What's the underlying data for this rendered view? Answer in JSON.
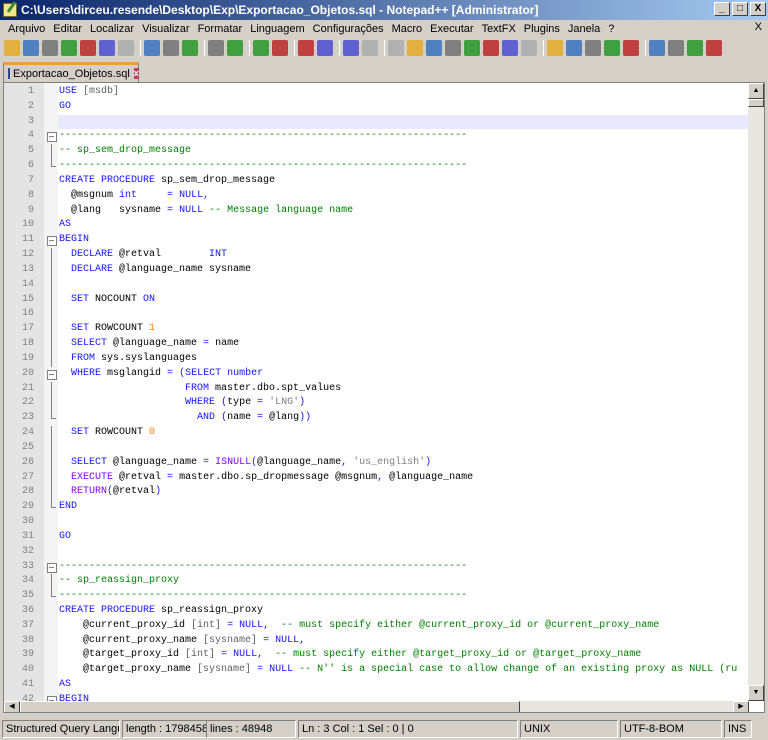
{
  "window": {
    "title": "C:\\Users\\dirceu.resende\\Desktop\\Exp\\Exportacao_Objetos.sql - Notepad++ [Administrator]",
    "minimize": "_",
    "maximize": "□",
    "close": "X"
  },
  "menu": {
    "items": [
      "Arquivo",
      "Editar",
      "Localizar",
      "Visualizar",
      "Formatar",
      "Linguagem",
      "Configurações",
      "Macro",
      "Executar",
      "TextFX",
      "Plugins",
      "Janela",
      "?"
    ],
    "close": "X"
  },
  "toolbar": {
    "groups": [
      [
        "new-file",
        "open-file",
        "save",
        "save-all",
        "close",
        "close-all",
        "print"
      ],
      [
        "cut",
        "copy",
        "paste"
      ],
      [
        "undo",
        "redo"
      ],
      [
        "find",
        "replace"
      ],
      [
        "zoom-in",
        "zoom-out"
      ],
      [
        "sync-vertical",
        "sync-horizontal"
      ],
      [
        "word-wrap",
        "show-all-chars",
        "indent-guide",
        "user-language",
        "doc-map",
        "function-list",
        "folder-workspace",
        "monitoring"
      ],
      [
        "record-macro",
        "stop-record",
        "play-macro",
        "run-macro-multiple",
        "save-macro"
      ],
      [
        "sort-asc",
        "move-up",
        "move-down",
        "sort-desc"
      ]
    ]
  },
  "tabs": [
    {
      "label": "Exportacao_Objetos.sql",
      "active": true
    }
  ],
  "colors": {
    "keyword": "#1414ff",
    "comment": "#008000",
    "number": "#ff8000",
    "string": "#808080",
    "current_line": "#e8e8ff",
    "tab_accent": "#fa9c28"
  },
  "editor": {
    "current_line": 3,
    "lines": [
      {
        "n": "1",
        "fold": "",
        "tokens": [
          [
            "k",
            "USE"
          ],
          [
            "t",
            " "
          ],
          [
            "b",
            "[msdb]"
          ]
        ]
      },
      {
        "n": "2",
        "fold": "",
        "tokens": [
          [
            "k",
            "GO"
          ]
        ]
      },
      {
        "n": "3",
        "fold": "",
        "tokens": []
      },
      {
        "n": "4",
        "fold": "box",
        "tokens": [
          [
            "c",
            "--------------------------------------------------------------------"
          ]
        ]
      },
      {
        "n": "5",
        "fold": "line",
        "tokens": [
          [
            "c",
            "-- sp_sem_drop_message"
          ]
        ]
      },
      {
        "n": "6",
        "fold": "end",
        "tokens": [
          [
            "c",
            "--------------------------------------------------------------------"
          ]
        ]
      },
      {
        "n": "7",
        "fold": "",
        "tokens": [
          [
            "k",
            "CREATE PROCEDURE"
          ],
          [
            "t",
            " sp_sem_drop_message"
          ]
        ]
      },
      {
        "n": "8",
        "fold": "",
        "tokens": [
          [
            "t",
            "  @msgnum "
          ],
          [
            "k",
            "int"
          ],
          [
            "t",
            "     "
          ],
          [
            "o",
            "="
          ],
          [
            "t",
            " "
          ],
          [
            "k",
            "NULL"
          ],
          [
            "o",
            ","
          ]
        ]
      },
      {
        "n": "9",
        "fold": "",
        "tokens": [
          [
            "t",
            "  @lang   sysname "
          ],
          [
            "o",
            "="
          ],
          [
            "t",
            " "
          ],
          [
            "k",
            "NULL"
          ],
          [
            "t",
            " "
          ],
          [
            "c",
            "-- Message language name"
          ]
        ]
      },
      {
        "n": "10",
        "fold": "",
        "tokens": [
          [
            "k",
            "AS"
          ]
        ]
      },
      {
        "n": "11",
        "fold": "box",
        "tokens": [
          [
            "k",
            "BEGIN"
          ]
        ]
      },
      {
        "n": "12",
        "fold": "line",
        "tokens": [
          [
            "t",
            "  "
          ],
          [
            "k",
            "DECLARE"
          ],
          [
            "t",
            " @retval        "
          ],
          [
            "k",
            "INT"
          ]
        ]
      },
      {
        "n": "13",
        "fold": "line",
        "tokens": [
          [
            "t",
            "  "
          ],
          [
            "k",
            "DECLARE"
          ],
          [
            "t",
            " @language_name sysname"
          ]
        ]
      },
      {
        "n": "14",
        "fold": "line",
        "tokens": []
      },
      {
        "n": "15",
        "fold": "line",
        "tokens": [
          [
            "t",
            "  "
          ],
          [
            "k",
            "SET"
          ],
          [
            "t",
            " NOCOUNT "
          ],
          [
            "k",
            "ON"
          ]
        ]
      },
      {
        "n": "16",
        "fold": "line",
        "tokens": []
      },
      {
        "n": "17",
        "fold": "line",
        "tokens": [
          [
            "t",
            "  "
          ],
          [
            "k",
            "SET"
          ],
          [
            "t",
            " ROWCOUNT "
          ],
          [
            "n",
            "1"
          ]
        ]
      },
      {
        "n": "18",
        "fold": "line",
        "tokens": [
          [
            "t",
            "  "
          ],
          [
            "k",
            "SELECT"
          ],
          [
            "t",
            " @language_name "
          ],
          [
            "o",
            "="
          ],
          [
            "t",
            " name"
          ]
        ]
      },
      {
        "n": "19",
        "fold": "line",
        "tokens": [
          [
            "t",
            "  "
          ],
          [
            "k",
            "FROM"
          ],
          [
            "t",
            " sys.syslanguages"
          ]
        ]
      },
      {
        "n": "20",
        "fold": "box",
        "tokens": [
          [
            "t",
            "  "
          ],
          [
            "k",
            "WHERE"
          ],
          [
            "t",
            " msglangid "
          ],
          [
            "o",
            "="
          ],
          [
            "t",
            " "
          ],
          [
            "o",
            "("
          ],
          [
            "k",
            "SELECT"
          ],
          [
            "t",
            " "
          ],
          [
            "k",
            "number"
          ]
        ]
      },
      {
        "n": "21",
        "fold": "line",
        "tokens": [
          [
            "t",
            "                     "
          ],
          [
            "k",
            "FROM"
          ],
          [
            "t",
            " master.dbo.spt_values"
          ]
        ]
      },
      {
        "n": "22",
        "fold": "line",
        "tokens": [
          [
            "t",
            "                     "
          ],
          [
            "k",
            "WHERE"
          ],
          [
            "t",
            " "
          ],
          [
            "o",
            "("
          ],
          [
            "t",
            "type "
          ],
          [
            "o",
            "="
          ],
          [
            "t",
            " "
          ],
          [
            "s",
            "'LNG'"
          ],
          [
            "o",
            ")"
          ]
        ]
      },
      {
        "n": "23",
        "fold": "end",
        "tokens": [
          [
            "t",
            "                       "
          ],
          [
            "k",
            "AND"
          ],
          [
            "t",
            " "
          ],
          [
            "o",
            "("
          ],
          [
            "t",
            "name "
          ],
          [
            "o",
            "="
          ],
          [
            "t",
            " @lang"
          ],
          [
            "o",
            "))"
          ]
        ]
      },
      {
        "n": "24",
        "fold": "line",
        "tokens": [
          [
            "t",
            "  "
          ],
          [
            "k",
            "SET"
          ],
          [
            "t",
            " ROWCOUNT "
          ],
          [
            "n",
            "0"
          ]
        ]
      },
      {
        "n": "25",
        "fold": "line",
        "tokens": []
      },
      {
        "n": "26",
        "fold": "line",
        "tokens": [
          [
            "t",
            "  "
          ],
          [
            "k",
            "SELECT"
          ],
          [
            "t",
            " @language_name "
          ],
          [
            "o",
            "="
          ],
          [
            "t",
            " "
          ],
          [
            "f",
            "ISNULL"
          ],
          [
            "o",
            "("
          ],
          [
            "t",
            "@language_name"
          ],
          [
            "o",
            ","
          ],
          [
            "t",
            " "
          ],
          [
            "s",
            "'us_english'"
          ],
          [
            "o",
            ")"
          ]
        ]
      },
      {
        "n": "27",
        "fold": "line",
        "tokens": [
          [
            "t",
            "  "
          ],
          [
            "f",
            "EXECUTE"
          ],
          [
            "t",
            " @retval "
          ],
          [
            "o",
            "="
          ],
          [
            "t",
            " master.dbo.sp_dropmessage @msgnum"
          ],
          [
            "o",
            ","
          ],
          [
            "t",
            " @language_name"
          ]
        ]
      },
      {
        "n": "28",
        "fold": "line",
        "tokens": [
          [
            "t",
            "  "
          ],
          [
            "f",
            "RETURN"
          ],
          [
            "o",
            "("
          ],
          [
            "t",
            "@retval"
          ],
          [
            "o",
            ")"
          ]
        ]
      },
      {
        "n": "29",
        "fold": "end",
        "tokens": [
          [
            "k",
            "END"
          ]
        ]
      },
      {
        "n": "30",
        "fold": "",
        "tokens": []
      },
      {
        "n": "31",
        "fold": "",
        "tokens": [
          [
            "k",
            "GO"
          ]
        ]
      },
      {
        "n": "32",
        "fold": "",
        "tokens": []
      },
      {
        "n": "33",
        "fold": "box",
        "tokens": [
          [
            "c",
            "--------------------------------------------------------------------"
          ]
        ]
      },
      {
        "n": "34",
        "fold": "line",
        "tokens": [
          [
            "c",
            "-- sp_reassign_proxy"
          ]
        ]
      },
      {
        "n": "35",
        "fold": "end",
        "tokens": [
          [
            "c",
            "--------------------------------------------------------------------"
          ]
        ]
      },
      {
        "n": "36",
        "fold": "",
        "tokens": [
          [
            "k",
            "CREATE PROCEDURE"
          ],
          [
            "t",
            " sp_reassign_proxy"
          ]
        ]
      },
      {
        "n": "37",
        "fold": "",
        "tokens": [
          [
            "t",
            "    @current_proxy_id "
          ],
          [
            "b",
            "[int]"
          ],
          [
            "t",
            " "
          ],
          [
            "o",
            "="
          ],
          [
            "t",
            " "
          ],
          [
            "k",
            "NULL"
          ],
          [
            "o",
            ","
          ],
          [
            "t",
            "  "
          ],
          [
            "c",
            "-- must specify either @current_proxy_id or @current_proxy_name"
          ]
        ]
      },
      {
        "n": "38",
        "fold": "",
        "tokens": [
          [
            "t",
            "    @current_proxy_name "
          ],
          [
            "b",
            "[sysname]"
          ],
          [
            "t",
            " "
          ],
          [
            "o",
            "="
          ],
          [
            "t",
            " "
          ],
          [
            "k",
            "NULL"
          ],
          [
            "o",
            ","
          ]
        ]
      },
      {
        "n": "39",
        "fold": "",
        "tokens": [
          [
            "t",
            "    @target_proxy_id "
          ],
          [
            "b",
            "[int]"
          ],
          [
            "t",
            " "
          ],
          [
            "o",
            "="
          ],
          [
            "t",
            " "
          ],
          [
            "k",
            "NULL"
          ],
          [
            "o",
            ","
          ],
          [
            "t",
            "  "
          ],
          [
            "c",
            "-- must specify either @target_proxy_id or @target_proxy_name"
          ]
        ]
      },
      {
        "n": "40",
        "fold": "",
        "tokens": [
          [
            "t",
            "    @target_proxy_name "
          ],
          [
            "b",
            "[sysname]"
          ],
          [
            "t",
            " "
          ],
          [
            "o",
            "="
          ],
          [
            "t",
            " "
          ],
          [
            "k",
            "NULL"
          ],
          [
            "t",
            " "
          ],
          [
            "c",
            "-- N'' is a special case to allow change of an existing proxy as NULL (ru"
          ]
        ]
      },
      {
        "n": "41",
        "fold": "",
        "tokens": [
          [
            "k",
            "AS"
          ]
        ]
      },
      {
        "n": "42",
        "fold": "box",
        "tokens": [
          [
            "k",
            "BEGIN"
          ]
        ]
      }
    ]
  },
  "status": {
    "language": "Structured Query Language",
    "length": "length : 1798458",
    "lines": "lines : 48948",
    "position": "Ln : 3    Col : 1    Sel : 0 | 0",
    "eol": "UNIX",
    "encoding": "UTF-8-BOM",
    "mode": "INS"
  }
}
